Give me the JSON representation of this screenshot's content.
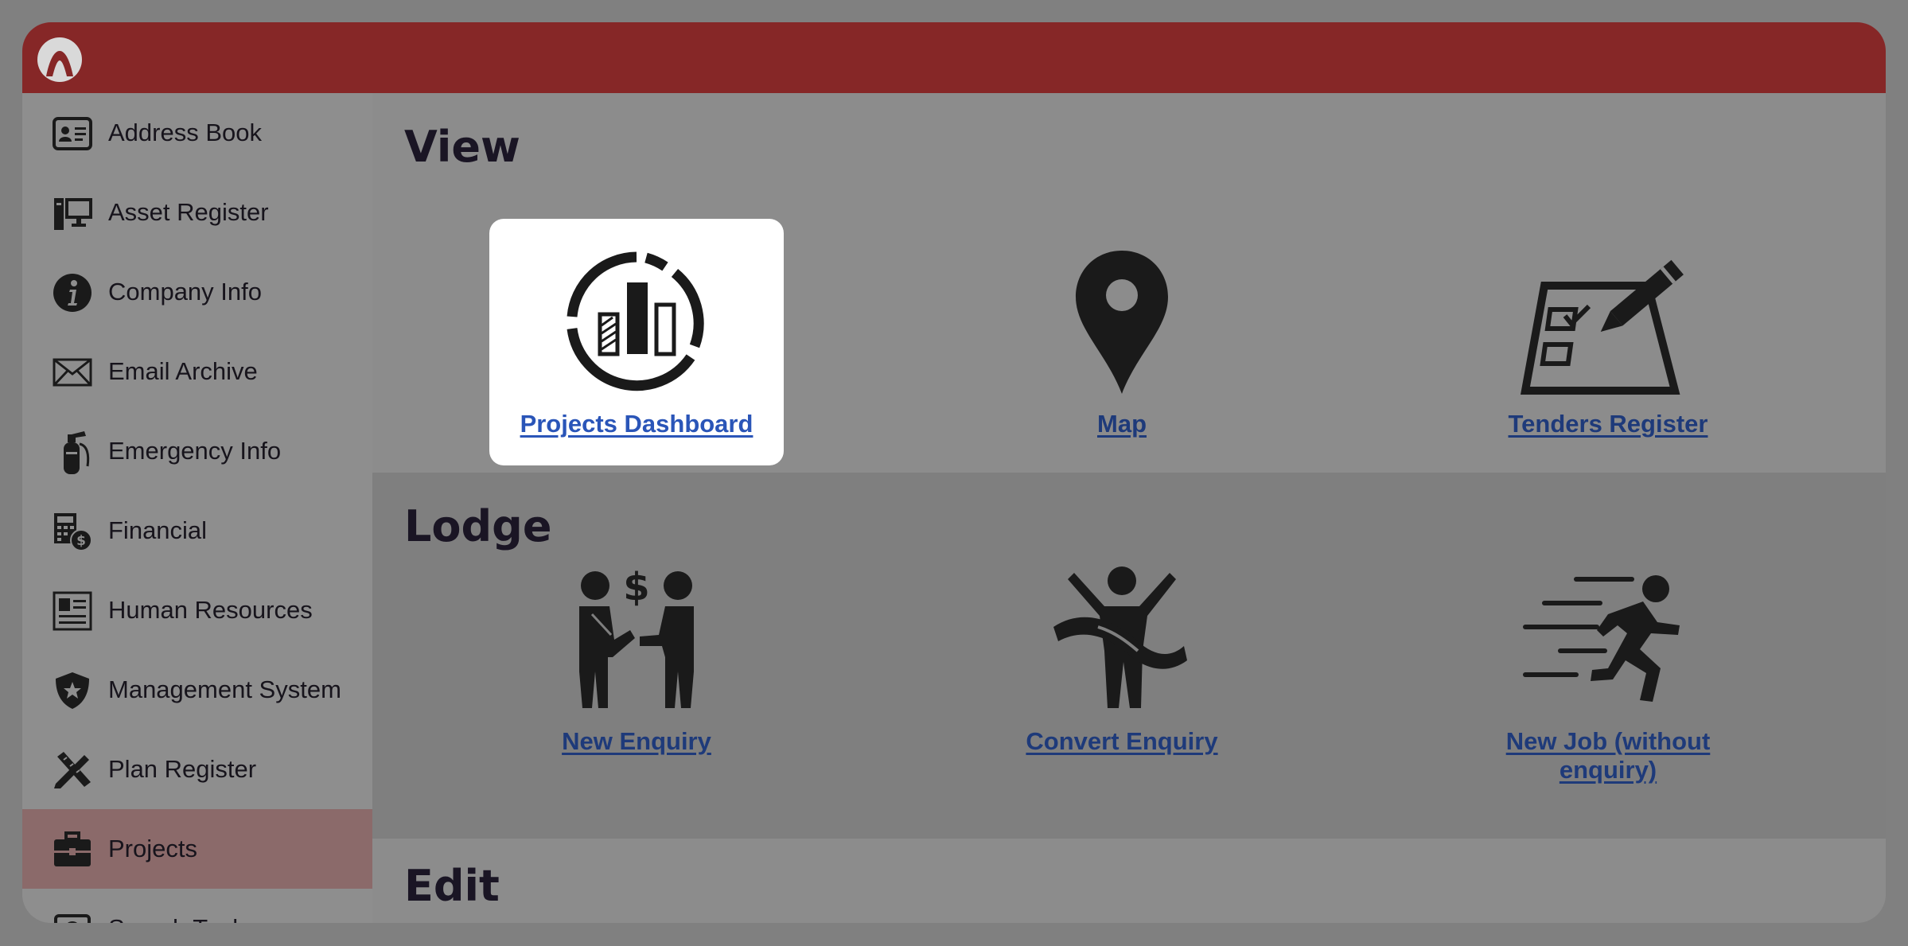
{
  "sidebar": {
    "items": [
      {
        "label": "Address Book",
        "icon": "address-card-icon"
      },
      {
        "label": "Asset Register",
        "icon": "computer-tower-icon"
      },
      {
        "label": "Company Info",
        "icon": "info-circle-icon"
      },
      {
        "label": "Email Archive",
        "icon": "envelope-icon"
      },
      {
        "label": "Emergency Info",
        "icon": "fire-extinguisher-icon"
      },
      {
        "label": "Financial",
        "icon": "calculator-dollar-icon"
      },
      {
        "label": "Human Resources",
        "icon": "id-badge-icon"
      },
      {
        "label": "Management System",
        "icon": "shield-star-icon"
      },
      {
        "label": "Plan Register",
        "icon": "drafting-tools-icon"
      },
      {
        "label": "Projects",
        "icon": "briefcase-icon",
        "active": true
      },
      {
        "label": "Search Tools",
        "icon": "search-tools-icon"
      }
    ]
  },
  "sections": {
    "view": {
      "title": "View",
      "tiles": [
        {
          "label": "Projects Dashboard",
          "icon": "dashboard-chart-icon",
          "highlighted": true
        },
        {
          "label": "Map",
          "icon": "map-pin-icon"
        },
        {
          "label": "Tenders Register",
          "icon": "checklist-pencil-icon"
        }
      ]
    },
    "lodge": {
      "title": "Lodge",
      "tiles": [
        {
          "label": "New Enquiry",
          "icon": "handshake-deal-icon"
        },
        {
          "label": "Convert Enquiry",
          "icon": "finish-line-icon"
        },
        {
          "label": "New Job (without enquiry)",
          "icon": "running-person-icon"
        }
      ]
    },
    "edit": {
      "title": "Edit"
    }
  },
  "colors": {
    "topbar": "#862727",
    "link": "#1e3a7a",
    "link_highlight": "#2a55b8",
    "active_item": "#8b6a6a"
  }
}
